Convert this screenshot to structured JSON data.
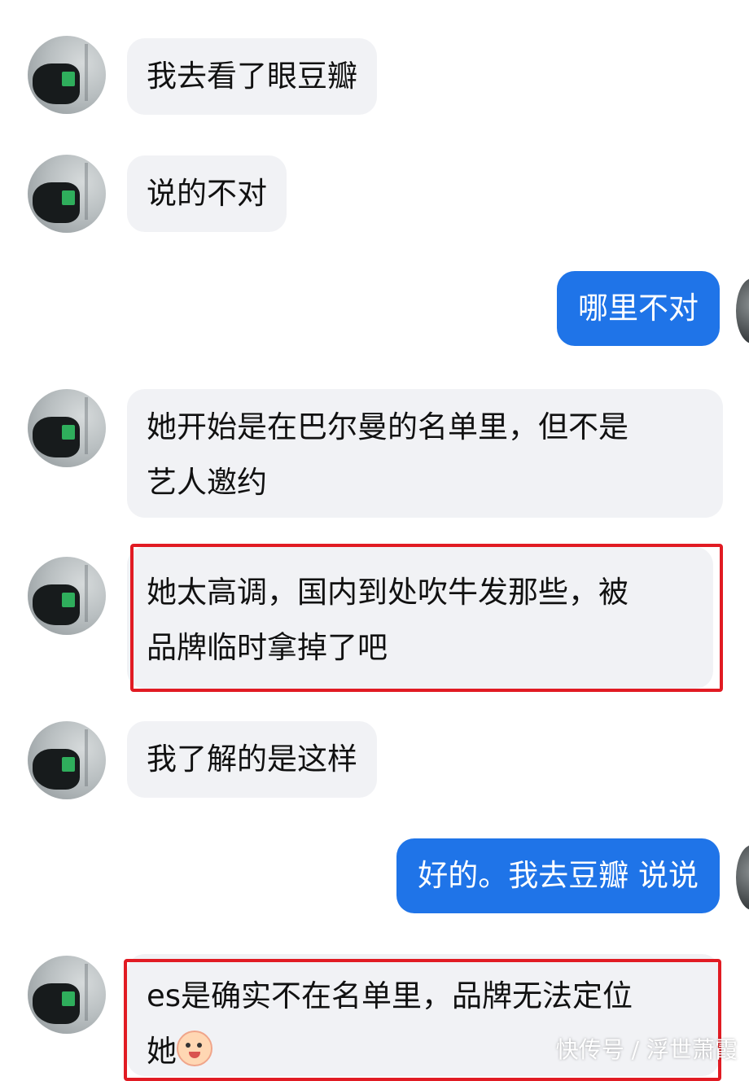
{
  "messages": [
    {
      "text": "我去看了眼豆瓣"
    },
    {
      "text": "说的不对"
    },
    {
      "text": "哪里不对"
    },
    {
      "line1": "她开始是在巴尔曼的名单里，但不是",
      "line2": "艺人邀约"
    },
    {
      "line1": "她太高调，国内到处吹牛发那些，被",
      "line2": "品牌临时拿掉了吧"
    },
    {
      "text": "我了解的是这样"
    },
    {
      "text": "好的。我去豆瓣 说说"
    },
    {
      "line1": "es是确实不在名单里，品牌无法定位",
      "line2": "她"
    }
  ],
  "emoji_icon": "crying-face-emoji",
  "watermark": "快传号 / 浮世萧霞",
  "colors": {
    "outgoing_bubble": "#1f74e8",
    "incoming_bubble": "#f1f2f5",
    "highlight_box": "#e11b23"
  }
}
